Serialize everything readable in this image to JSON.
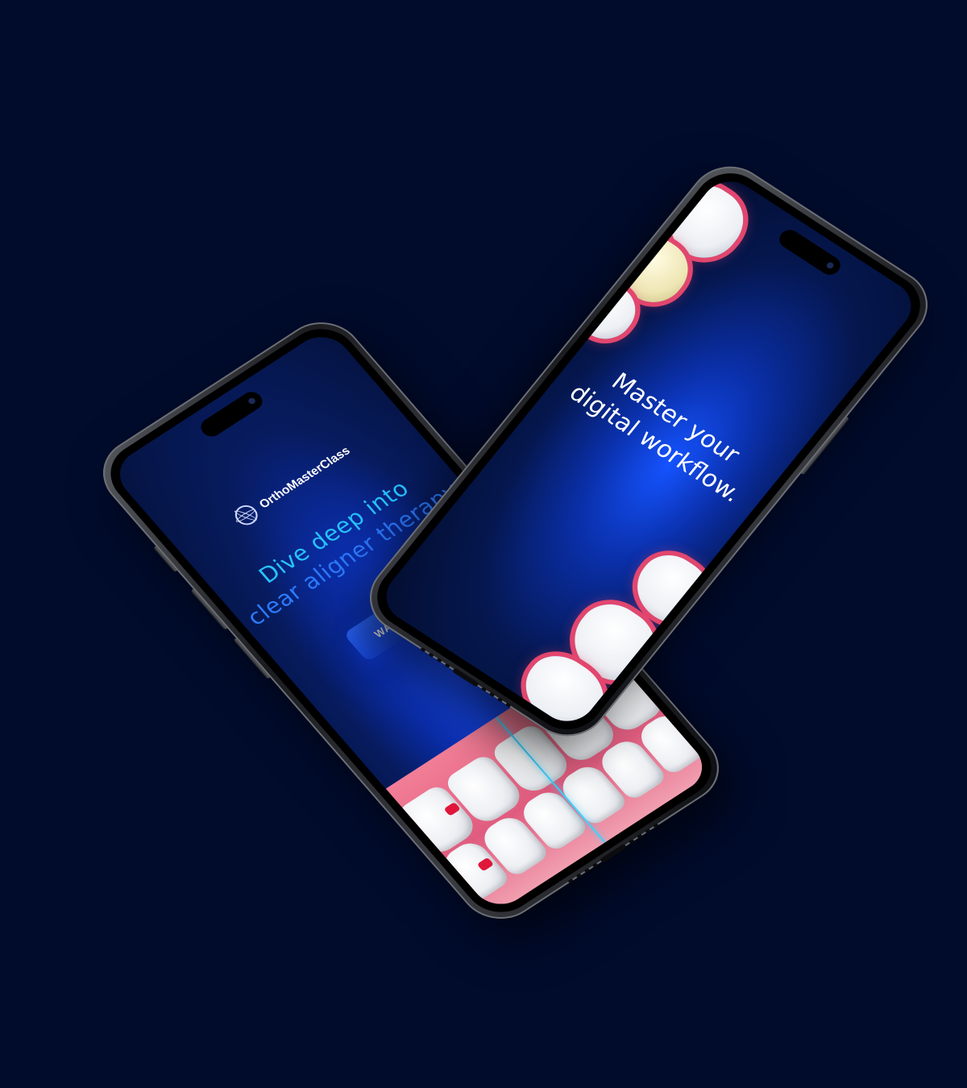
{
  "phone_left": {
    "brand": {
      "logo_icon": "atom-tooth-logo-icon",
      "name": "OrthoMasterClass"
    },
    "headline_line1": "Dive deep into",
    "headline_line2": "clear aligner therapy",
    "cta_label": "WATCH NOW",
    "colors": {
      "headline_line1": "#27c2ff",
      "headline_line2": "#2c7bff",
      "cta": "#1f5af5",
      "gum": "#e8798f"
    }
  },
  "phone_right": {
    "headline_line1": "Master your",
    "headline_line2": "digital workflow."
  },
  "background_color": "#010b2c"
}
